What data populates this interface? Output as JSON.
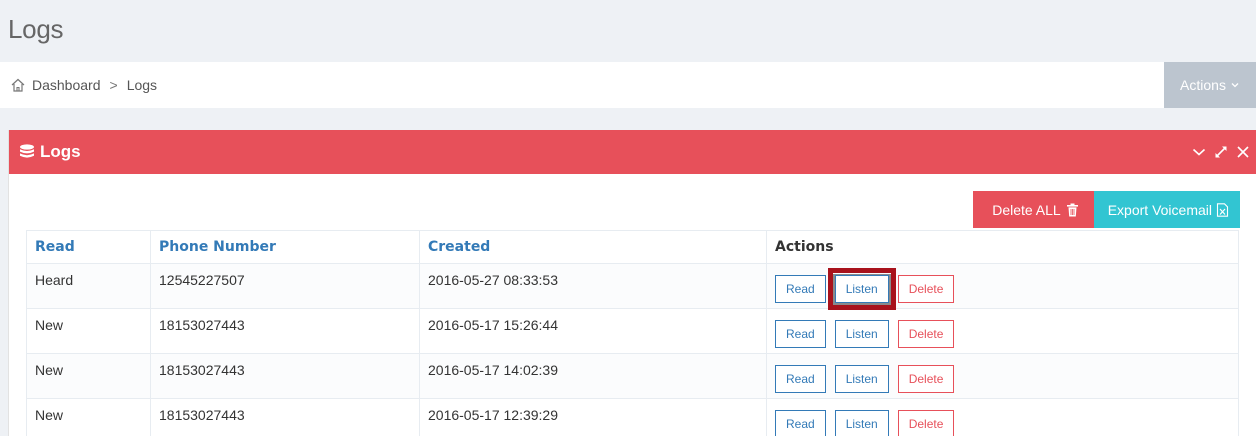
{
  "page": {
    "title": "Logs"
  },
  "breadcrumb": {
    "home_label": "Dashboard",
    "separator": ">",
    "current": "Logs"
  },
  "header": {
    "actions_label": "Actions"
  },
  "portlet": {
    "title": "Logs",
    "delete_all_label": "Delete ALL",
    "export_label": "Export Voicemail"
  },
  "table": {
    "headers": {
      "read": "Read",
      "phone": "Phone Number",
      "created": "Created",
      "actions": "Actions"
    },
    "rows": [
      {
        "read": "Heard",
        "phone": "12545227507",
        "created": "2016-05-27 08:33:53"
      },
      {
        "read": "New",
        "phone": "18153027443",
        "created": "2016-05-17 15:26:44"
      },
      {
        "read": "New",
        "phone": "18153027443",
        "created": "2016-05-17 14:02:39"
      },
      {
        "read": "New",
        "phone": "18153027443",
        "created": "2016-05-17 12:39:29"
      }
    ],
    "row_buttons": {
      "read": "Read",
      "listen": "Listen",
      "delete": "Delete"
    }
  },
  "colors": {
    "accent_red": "#e7505a",
    "accent_cyan": "#32c5d2",
    "link_blue": "#337ab7",
    "highlight": "#a8121c"
  }
}
